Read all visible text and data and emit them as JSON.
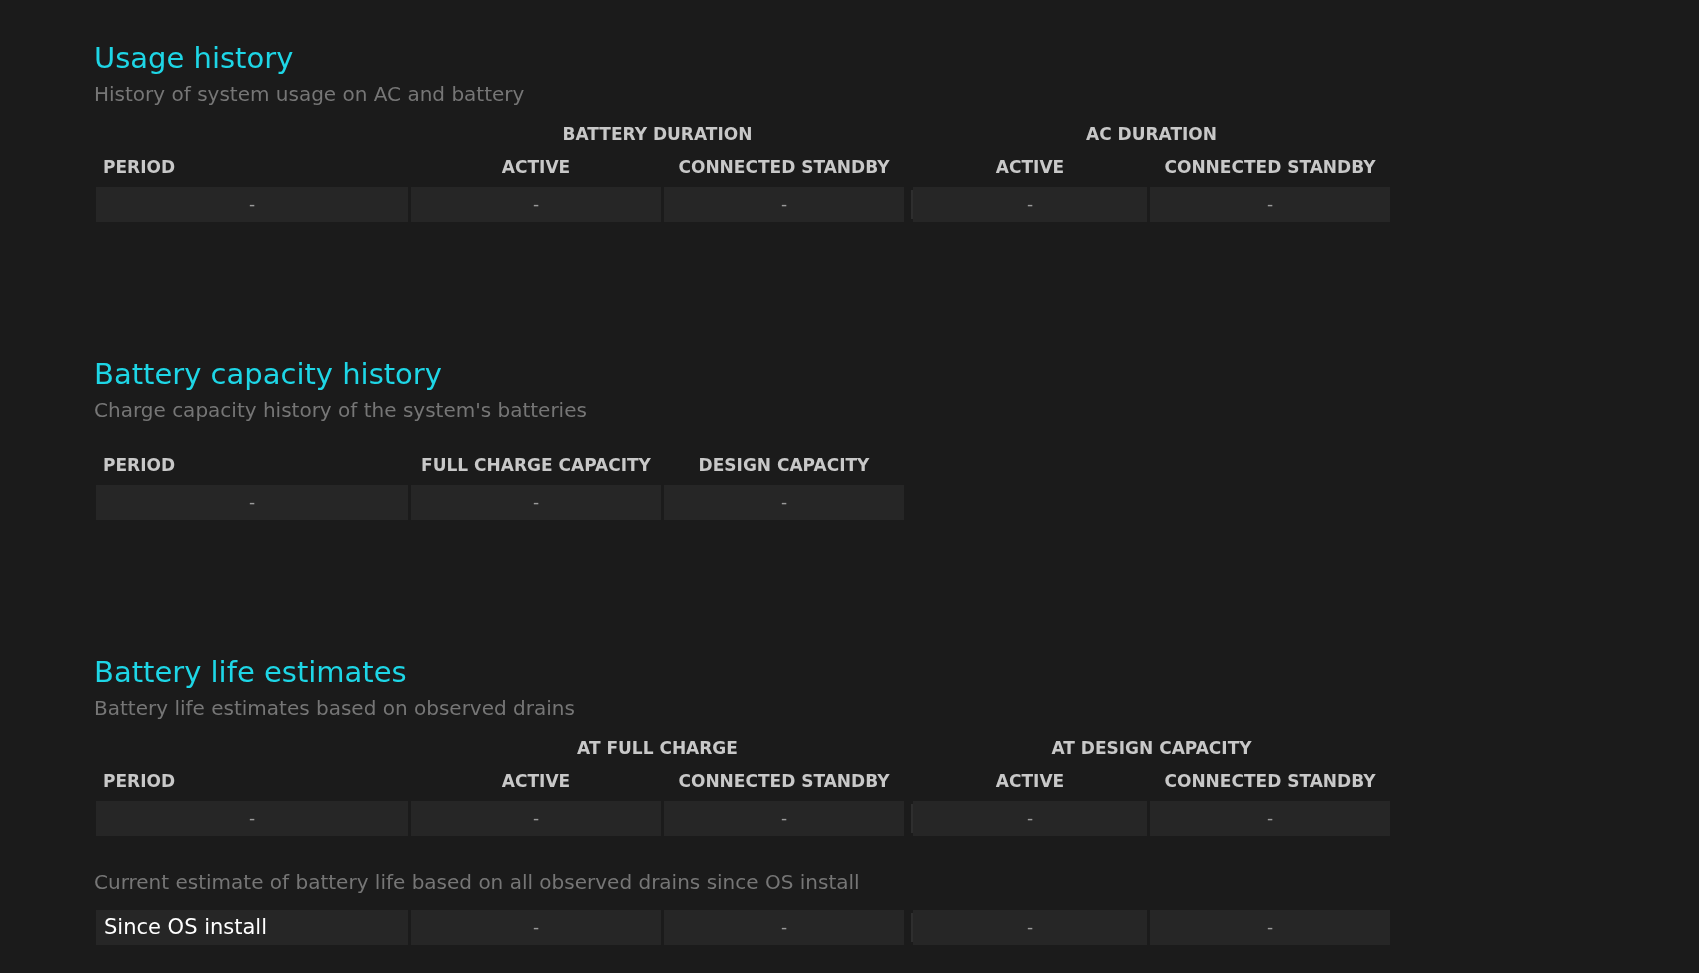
{
  "sections": [
    {
      "title": "Usage history",
      "subtitle": "History of system usage on AC and battery",
      "group_headers": [
        "BATTERY DURATION",
        "AC DURATION"
      ],
      "columns": [
        "PERIOD",
        "ACTIVE",
        "CONNECTED STANDBY",
        "ACTIVE",
        "CONNECTED STANDBY"
      ],
      "rows": [
        [
          "-",
          "-",
          "-",
          "-",
          "-"
        ]
      ]
    },
    {
      "title": "Battery capacity history",
      "subtitle": "Charge capacity history of the system's batteries",
      "columns": [
        "PERIOD",
        "FULL CHARGE CAPACITY",
        "DESIGN CAPACITY"
      ],
      "rows": [
        [
          "-",
          "-",
          "-"
        ]
      ]
    },
    {
      "title": "Battery life estimates",
      "subtitle": "Battery life estimates based on observed drains",
      "group_headers": [
        "AT FULL CHARGE",
        "AT DESIGN CAPACITY"
      ],
      "columns": [
        "PERIOD",
        "ACTIVE",
        "CONNECTED STANDBY",
        "ACTIVE",
        "CONNECTED STANDBY"
      ],
      "rows": [
        [
          "-",
          "-",
          "-",
          "-",
          "-"
        ]
      ],
      "note": "Current estimate of battery life based on all observed drains since OS install",
      "summary_rows": [
        [
          "Since OS install",
          "-",
          "-",
          "-",
          "-"
        ]
      ]
    }
  ]
}
